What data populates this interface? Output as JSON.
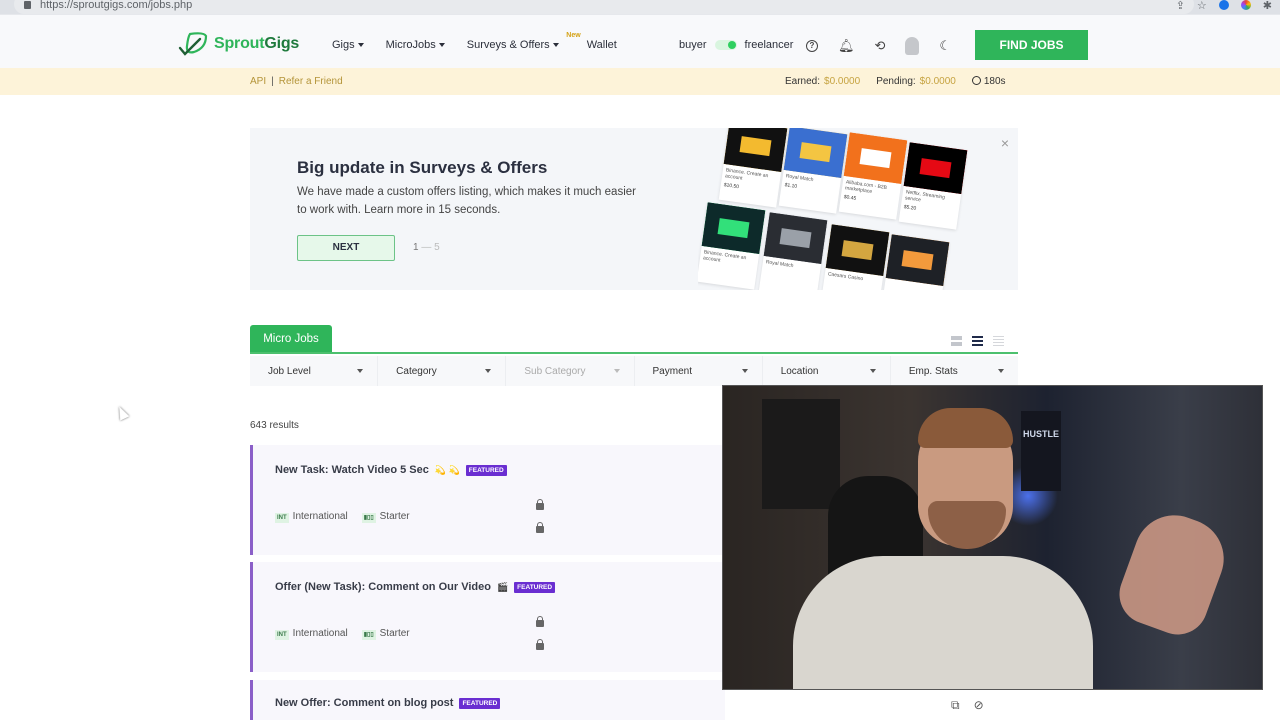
{
  "browser": {
    "url": "https://sproutgigs.com/jobs.php",
    "icons": [
      "share-icon",
      "star-icon",
      "extension-blue-icon",
      "extension-color-icon",
      "puzzle-icon"
    ]
  },
  "header": {
    "logo_text_a": "Sprout",
    "logo_text_b": "Gigs",
    "nav": [
      {
        "label": "Gigs",
        "dropdown": true
      },
      {
        "label": "MicroJobs",
        "dropdown": true
      },
      {
        "label": "Surveys & Offers",
        "dropdown": true,
        "badge": "New"
      },
      {
        "label": "Wallet",
        "dropdown": false
      }
    ],
    "role_left": "buyer",
    "role_right": "freelancer",
    "role_active": "freelancer",
    "icons": [
      "help-icon",
      "bell-icon",
      "history-icon",
      "avatar-icon",
      "moon-icon"
    ],
    "find_jobs_label": "FIND JOBS",
    "accent_color": "#2fb55a"
  },
  "subbar": {
    "api_label": "API",
    "separator": "|",
    "refer_label": "Refer a Friend",
    "earned_label": "Earned:",
    "earned_value": "$0.0000",
    "pending_label": "Pending:",
    "pending_value": "$0.0000",
    "timer": "180s"
  },
  "promo": {
    "title": "Big update in Surveys & Offers",
    "description": "We have made a custom offers listing, which makes it much easier to work with. Learn more in 15 seconds.",
    "next_label": "NEXT",
    "pager_current": "1",
    "pager_sep": "—",
    "pager_total": "5",
    "close_label": "×",
    "tiles": [
      {
        "name": "Binance. Create an account",
        "price": "$10.50",
        "color": "#111111",
        "accent": "#f3ba2f"
      },
      {
        "name": "Royal Match",
        "price": "$1.10",
        "color": "#3a6fd0",
        "accent": "#f4c542"
      },
      {
        "name": "Alibaba.com - B2B marketplace",
        "price": "$0.45",
        "color": "#f2711c",
        "accent": "#ffffff"
      },
      {
        "name": "Netflix. Streaming service",
        "price": "$5.20",
        "color": "#000000",
        "accent": "#e50914"
      },
      {
        "name": "Binance. Create an account",
        "price": "",
        "color": "#0d2a2a",
        "accent": "#32e07a"
      },
      {
        "name": "Royal Match",
        "price": "",
        "color": "#2a2d33",
        "accent": "#9aa0a8"
      },
      {
        "name": "Caesars Casino",
        "price": "",
        "color": "#111111",
        "accent": "#d4a640"
      },
      {
        "name": "",
        "price": "",
        "color": "#1e2126",
        "accent": "#f39a3c"
      }
    ]
  },
  "tabs": {
    "active": "Micro Jobs",
    "view_modes": [
      "compact-view-icon",
      "list-view-icon",
      "detail-view-icon"
    ]
  },
  "filters": [
    {
      "label": "Job Level",
      "disabled": false
    },
    {
      "label": "Category",
      "disabled": false
    },
    {
      "label": "Sub Category",
      "disabled": true
    },
    {
      "label": "Payment",
      "disabled": false
    },
    {
      "label": "Location",
      "disabled": false
    },
    {
      "label": "Emp. Stats",
      "disabled": false
    }
  ],
  "results_count": "643 results",
  "jobs": [
    {
      "title": "New Task: Watch Video 5 Sec",
      "emoji": "💫 💫",
      "badge": "FEATURED",
      "location_tag": "INT",
      "location": "International",
      "level": "Starter"
    },
    {
      "title": "Offer (New Task): Comment on Our Video",
      "emoji": "🎬",
      "badge": "FEATURED",
      "location_tag": "INT",
      "location": "International",
      "level": "Starter"
    },
    {
      "title": "New Offer: Comment on blog post",
      "emoji": "",
      "badge": "FEATURED"
    }
  ],
  "video_overlay": {
    "poster_text": "HUSTLE"
  },
  "bottom_icons": [
    "external-link-icon",
    "hide-icon"
  ]
}
